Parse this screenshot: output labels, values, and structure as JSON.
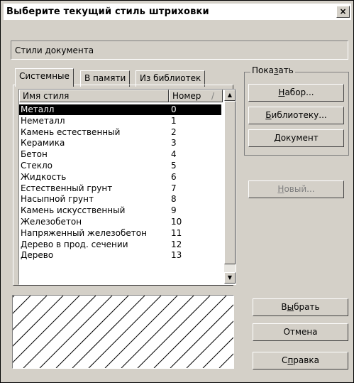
{
  "window": {
    "title": "Выберите текущий стиль штриховки",
    "close_glyph": "×"
  },
  "document_style_field": "Стили документа",
  "tabs": [
    {
      "label": "Системные",
      "active": true
    },
    {
      "label": "В памяти",
      "active": false
    },
    {
      "label": "Из библиотек",
      "active": false
    }
  ],
  "list": {
    "headers": {
      "name": "Имя стиля",
      "number": "Номер",
      "sort_mark": "/"
    },
    "rows": [
      {
        "name": "Металл",
        "number": "0",
        "selected": true
      },
      {
        "name": "Неметалл",
        "number": "1"
      },
      {
        "name": "Камень естественный",
        "number": "2"
      },
      {
        "name": "Керамика",
        "number": "3"
      },
      {
        "name": "Бетон",
        "number": "4"
      },
      {
        "name": "Стекло",
        "number": "5"
      },
      {
        "name": "Жидкость",
        "number": "6"
      },
      {
        "name": "Естественный грунт",
        "number": "7"
      },
      {
        "name": "Насыпной грунт",
        "number": "8"
      },
      {
        "name": "Камень искусственный",
        "number": "9"
      },
      {
        "name": "Железобетон",
        "number": "10"
      },
      {
        "name": "Напряженный железобетон",
        "number": "11"
      },
      {
        "name": "Дерево в прод. сечении",
        "number": "12"
      },
      {
        "name": "Дерево",
        "number": "13"
      }
    ]
  },
  "show_group": {
    "label_pre": "Пока",
    "label_u": "з",
    "label_post": "ать",
    "set": {
      "u": "Н",
      "rest": "абор..."
    },
    "library": {
      "u": "Б",
      "rest": "иблиотеку..."
    },
    "document": {
      "u": "Д",
      "rest": "окумент"
    }
  },
  "new_button": {
    "u": "Н",
    "rest": "овый..."
  },
  "select_button": {
    "pre": "В",
    "u": "ы",
    "rest": "брать"
  },
  "cancel_button": "Отмена",
  "help_button": {
    "pre": "С",
    "u": "п",
    "rest": "равка"
  },
  "icons": {
    "scroll_up": "▲",
    "scroll_down": "▼"
  }
}
